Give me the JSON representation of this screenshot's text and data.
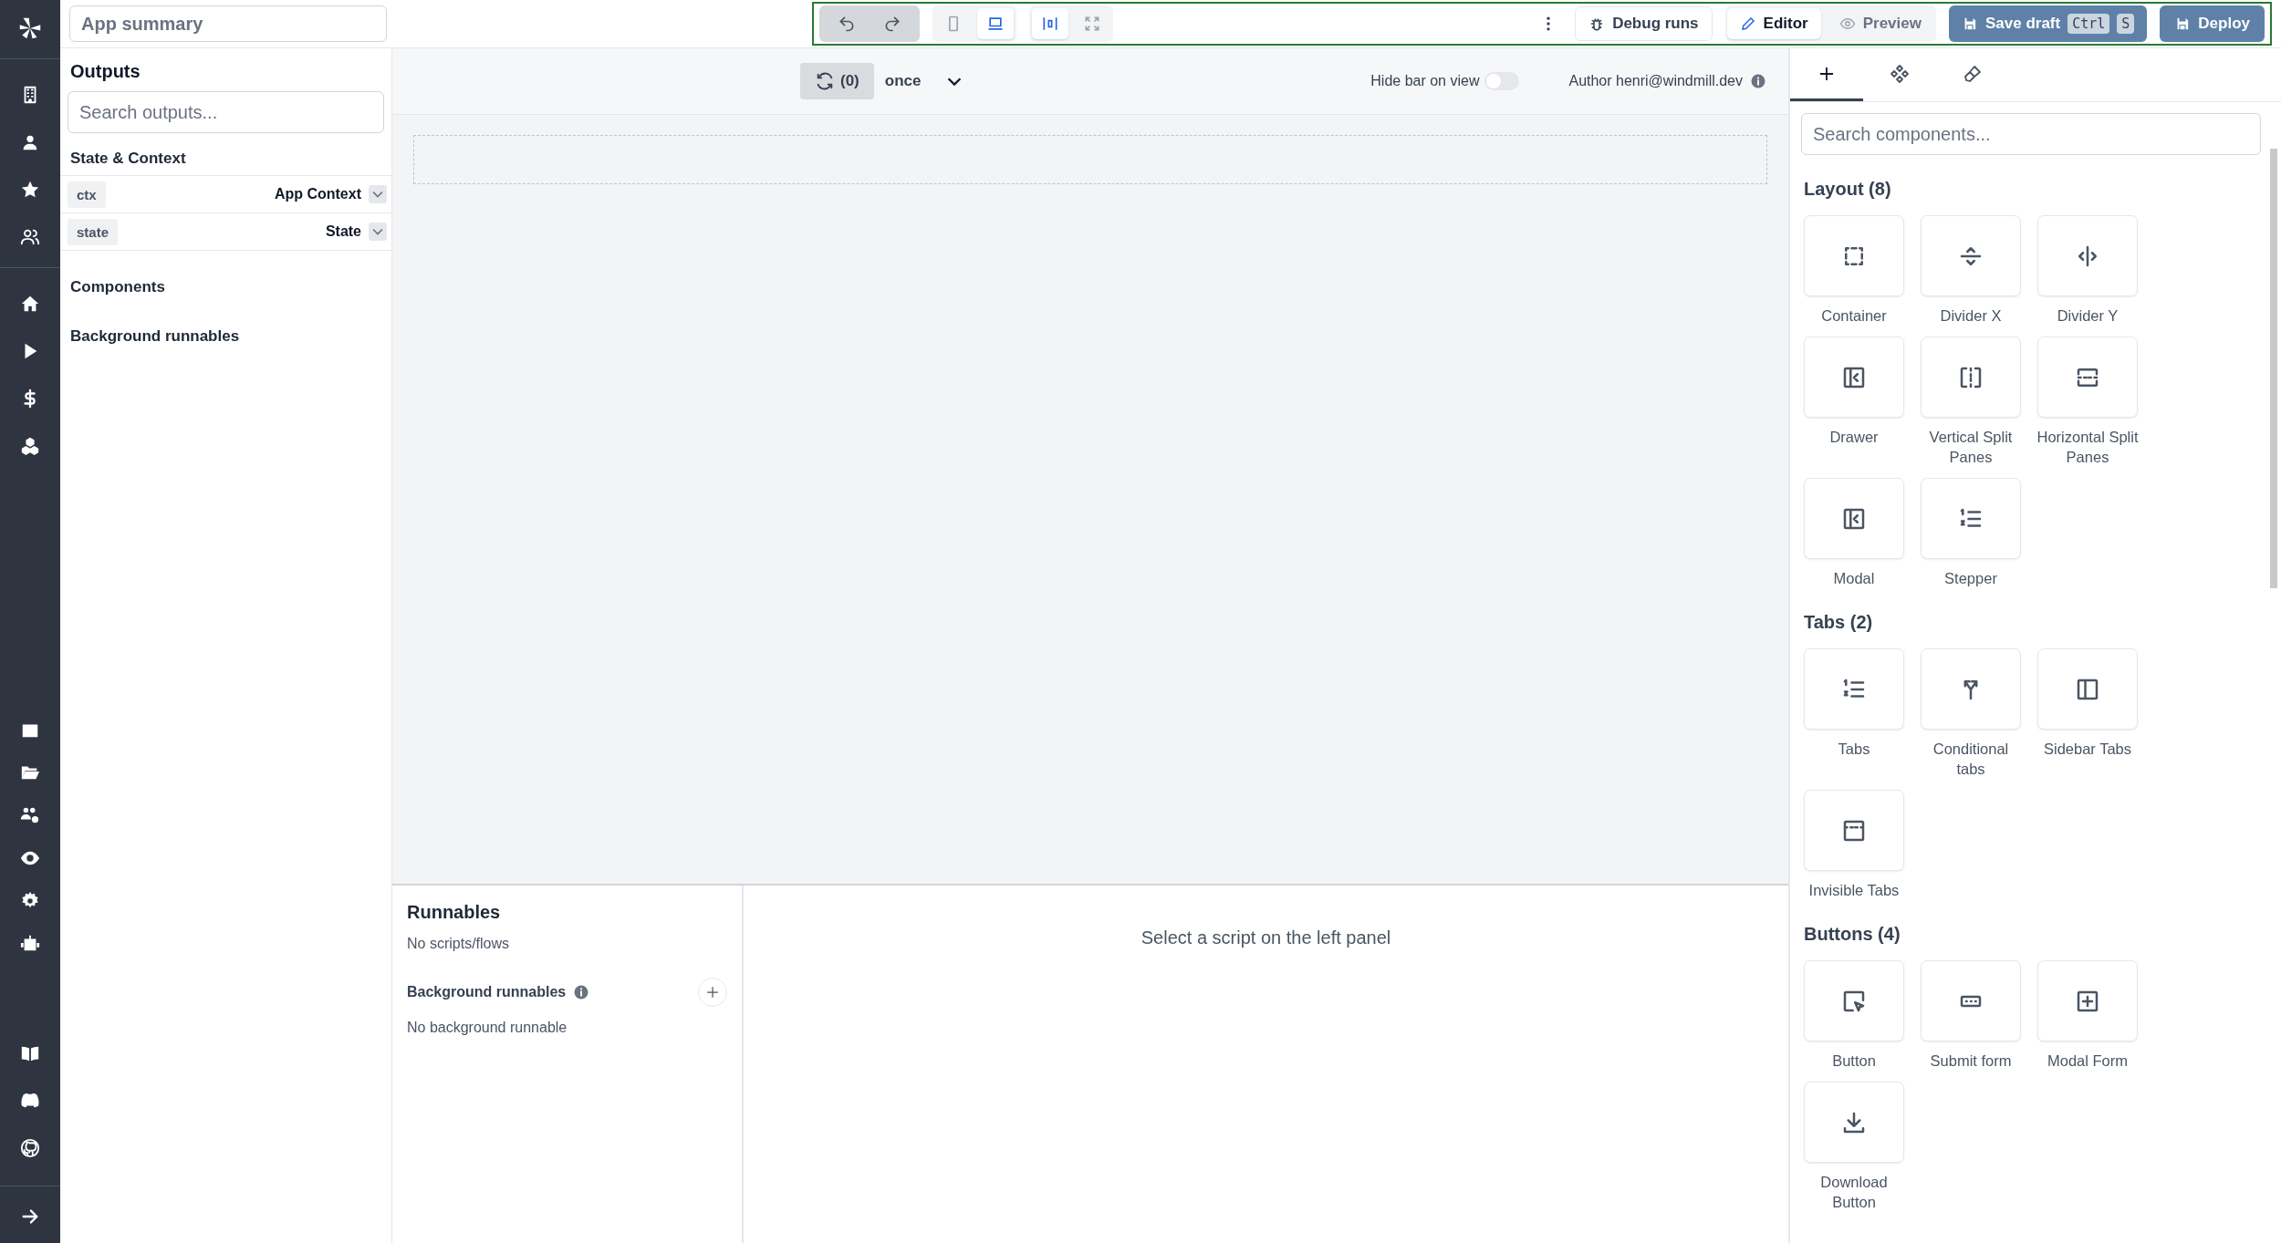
{
  "header": {
    "app_summary": "App summary"
  },
  "toolbar": {
    "view_buttons": [
      {
        "kind": "phone",
        "selected": false
      },
      {
        "kind": "laptop",
        "selected": true
      }
    ],
    "width_buttons": [
      {
        "kind": "fit",
        "selected": true
      },
      {
        "kind": "fullscreen",
        "selected": false
      }
    ],
    "debug_runs": "Debug runs",
    "modes": [
      {
        "kind": "editor",
        "label": "Editor",
        "selected": true
      },
      {
        "kind": "preview",
        "label": "Preview",
        "selected": false
      }
    ],
    "save_draft": {
      "label": "Save draft",
      "keys": [
        "Ctrl",
        "S"
      ]
    },
    "deploy": "Deploy"
  },
  "outputs": {
    "title": "Outputs",
    "search_placeholder": "Search outputs...",
    "state_context_title": "State & Context",
    "rows": [
      {
        "key": "ctx",
        "label": "App Context"
      },
      {
        "key": "state",
        "label": "State"
      }
    ],
    "sections": [
      "Components",
      "Background runnables"
    ]
  },
  "canvas_bar": {
    "refresh_count": "(0)",
    "schedule": "once",
    "hide_bar": {
      "label": "Hide bar on view",
      "on": false
    },
    "author": "Author henri@windmill.dev"
  },
  "runnables": {
    "title": "Runnables",
    "empty": "No scripts/flows",
    "background_title": "Background runnables",
    "background_empty": "No background runnable",
    "detail_message": "Select a script on the left panel"
  },
  "right_panel": {
    "tabs": [
      {
        "kind": "add",
        "selected": true
      },
      {
        "kind": "components",
        "selected": false
      },
      {
        "kind": "style",
        "selected": false
      }
    ],
    "search_placeholder": "Search components...",
    "groups": [
      {
        "title": "Layout (8)",
        "items": [
          {
            "label": "Container",
            "kind": "container"
          },
          {
            "label": "Divider X",
            "kind": "divider_x"
          },
          {
            "label": "Divider Y",
            "kind": "divider_y"
          },
          {
            "label": "Drawer",
            "kind": "drawer"
          },
          {
            "label": "Vertical Split Panes",
            "kind": "vsplit"
          },
          {
            "label": "Horizontal Split Panes",
            "kind": "hsplit"
          },
          {
            "label": "Modal",
            "kind": "drawer"
          },
          {
            "label": "Stepper",
            "kind": "list"
          }
        ]
      },
      {
        "title": "Tabs (2)",
        "items": [
          {
            "label": "Tabs",
            "kind": "list"
          },
          {
            "label": "Conditional tabs",
            "kind": "conditional"
          },
          {
            "label": "Sidebar Tabs",
            "kind": "sidebar"
          },
          {
            "label": "Invisible Tabs",
            "kind": "invisible"
          }
        ]
      },
      {
        "title": "Buttons (4)",
        "items": [
          {
            "label": "Button",
            "kind": "button"
          },
          {
            "label": "Submit form",
            "kind": "submit"
          },
          {
            "label": "Modal Form",
            "kind": "modal_form"
          },
          {
            "label": "Download Button",
            "kind": "download"
          }
        ]
      }
    ]
  }
}
